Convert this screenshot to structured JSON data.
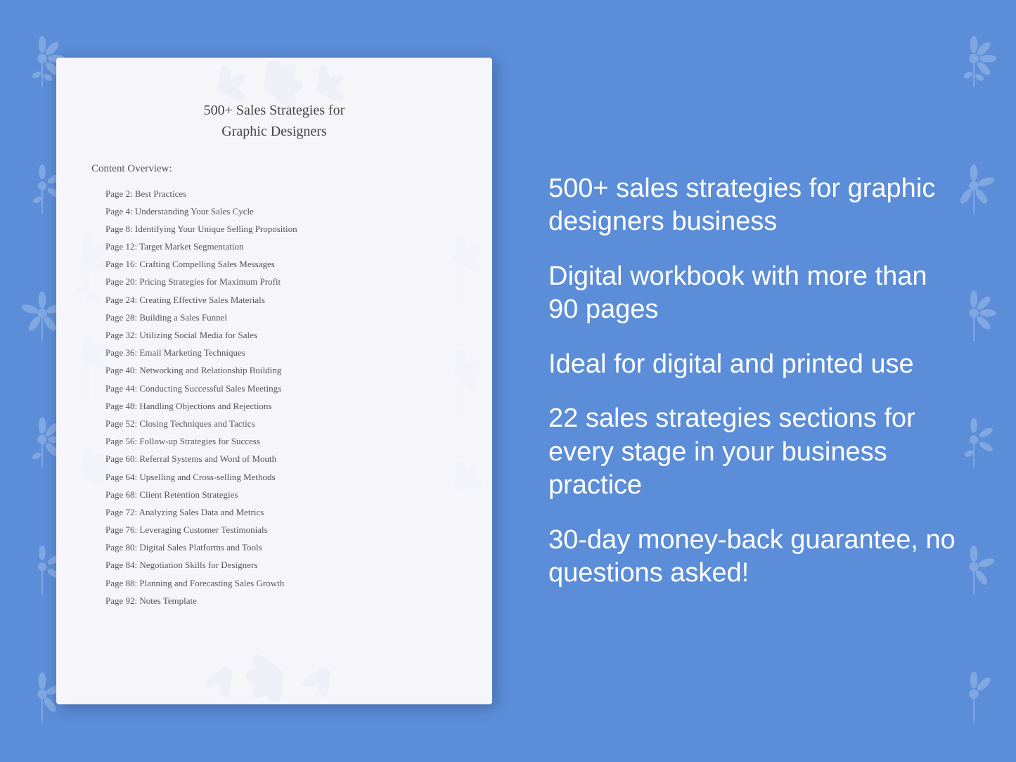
{
  "background": {
    "color": "#5b8dd9"
  },
  "document": {
    "title_line1": "500+ Sales Strategies for",
    "title_line2": "Graphic Designers",
    "toc_heading": "Content Overview:",
    "toc_items": [
      {
        "page": "Page  2:",
        "title": "Best Practices"
      },
      {
        "page": "Page  4:",
        "title": "Understanding Your Sales Cycle"
      },
      {
        "page": "Page  8:",
        "title": "Identifying Your Unique Selling Proposition"
      },
      {
        "page": "Page 12:",
        "title": "Target Market Segmentation"
      },
      {
        "page": "Page 16:",
        "title": "Crafting Compelling Sales Messages"
      },
      {
        "page": "Page 20:",
        "title": "Pricing Strategies for Maximum Profit"
      },
      {
        "page": "Page 24:",
        "title": "Creating Effective Sales Materials"
      },
      {
        "page": "Page 28:",
        "title": "Building a Sales Funnel"
      },
      {
        "page": "Page 32:",
        "title": "Utilizing Social Media for Sales"
      },
      {
        "page": "Page 36:",
        "title": "Email Marketing Techniques"
      },
      {
        "page": "Page 40:",
        "title": "Networking and Relationship Building"
      },
      {
        "page": "Page 44:",
        "title": "Conducting Successful Sales Meetings"
      },
      {
        "page": "Page 48:",
        "title": "Handling Objections and Rejections"
      },
      {
        "page": "Page 52:",
        "title": "Closing Techniques and Tactics"
      },
      {
        "page": "Page 56:",
        "title": "Follow-up Strategies for Success"
      },
      {
        "page": "Page 60:",
        "title": "Referral Systems and Word of Mouth"
      },
      {
        "page": "Page 64:",
        "title": "Upselling and Cross-selling Methods"
      },
      {
        "page": "Page 68:",
        "title": "Client Retention Strategies"
      },
      {
        "page": "Page 72:",
        "title": "Analyzing Sales Data and Metrics"
      },
      {
        "page": "Page 76:",
        "title": "Leveraging Customer Testimonials"
      },
      {
        "page": "Page 80:",
        "title": "Digital Sales Platforms and Tools"
      },
      {
        "page": "Page 84:",
        "title": "Negotiation Skills for Designers"
      },
      {
        "page": "Page 88:",
        "title": "Planning and Forecasting Sales Growth"
      },
      {
        "page": "Page 92:",
        "title": "Notes Template"
      }
    ]
  },
  "features": [
    "500+ sales strategies for graphic designers business",
    "Digital workbook with more than 90 pages",
    "Ideal for digital and printed use",
    "22 sales strategies sections for every stage in your business practice",
    "30-day money-back guarantee, no questions asked!"
  ]
}
